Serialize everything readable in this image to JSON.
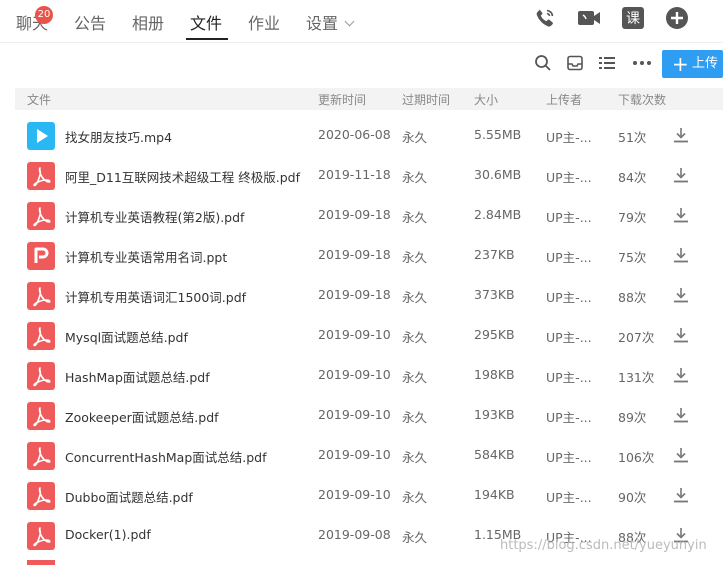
{
  "nav": {
    "tabs": [
      {
        "label": "聊天"
      },
      {
        "label": "公告"
      },
      {
        "label": "相册"
      },
      {
        "label": "文件"
      },
      {
        "label": "作业"
      },
      {
        "label": "设置"
      }
    ],
    "badge": "20",
    "active_tab": "文件",
    "course_icon_label": "课"
  },
  "toolbar": {
    "icons": [
      "search-icon",
      "inbox-icon",
      "list-view-icon",
      "more-icon"
    ],
    "upload_label": "上传"
  },
  "table": {
    "columns": [
      "文件",
      "更新时间",
      "过期时间",
      "大小",
      "上传者",
      "下载次数"
    ],
    "rows": [
      {
        "type": "mp4",
        "name": "找女朋友技巧.mp4",
        "date": "2020-06-08",
        "expire": "永久",
        "size": "5.55MB",
        "uploader": "UP主-...",
        "downloads": "51次"
      },
      {
        "type": "pdf",
        "name": "阿里_D11互联网技术超级工程 终极版.pdf",
        "date": "2019-11-18",
        "expire": "永久",
        "size": "30.6MB",
        "uploader": "UP主-...",
        "downloads": "84次"
      },
      {
        "type": "pdf",
        "name": "计算机专业英语教程(第2版).pdf",
        "date": "2019-09-18",
        "expire": "永久",
        "size": "2.84MB",
        "uploader": "UP主-...",
        "downloads": "79次"
      },
      {
        "type": "ppt",
        "name": "计算机专业英语常用名词.ppt",
        "date": "2019-09-18",
        "expire": "永久",
        "size": "237KB",
        "uploader": "UP主-...",
        "downloads": "75次"
      },
      {
        "type": "pdf",
        "name": "计算机专用英语词汇1500词.pdf",
        "date": "2019-09-18",
        "expire": "永久",
        "size": "373KB",
        "uploader": "UP主-...",
        "downloads": "88次"
      },
      {
        "type": "pdf",
        "name": "Mysql面试题总结.pdf",
        "date": "2019-09-10",
        "expire": "永久",
        "size": "295KB",
        "uploader": "UP主-...",
        "downloads": "207次"
      },
      {
        "type": "pdf",
        "name": "HashMap面试题总结.pdf",
        "date": "2019-09-10",
        "expire": "永久",
        "size": "198KB",
        "uploader": "UP主-...",
        "downloads": "131次"
      },
      {
        "type": "pdf",
        "name": "Zookeeper面试题总结.pdf",
        "date": "2019-09-10",
        "expire": "永久",
        "size": "193KB",
        "uploader": "UP主-...",
        "downloads": "89次"
      },
      {
        "type": "pdf",
        "name": "ConcurrentHashMap面试总结.pdf",
        "date": "2019-09-10",
        "expire": "永久",
        "size": "584KB",
        "uploader": "UP主-...",
        "downloads": "106次"
      },
      {
        "type": "pdf",
        "name": "Dubbo面试题总结.pdf",
        "date": "2019-09-10",
        "expire": "永久",
        "size": "194KB",
        "uploader": "UP主-...",
        "downloads": "90次"
      },
      {
        "type": "pdf",
        "name": "Docker(1).pdf",
        "date": "2019-09-08",
        "expire": "永久",
        "size": "1.15MB",
        "uploader": "UP主-...",
        "downloads": "88次"
      }
    ]
  },
  "watermark": "https://blog.csdn.net/yueyunyin",
  "colors": {
    "accent_blue": "#2f9df1",
    "pdf_red": "#ef5b5b",
    "video_blue": "#2ab8f5",
    "badge_red": "#e8534a",
    "icon_dark": "#555555"
  }
}
